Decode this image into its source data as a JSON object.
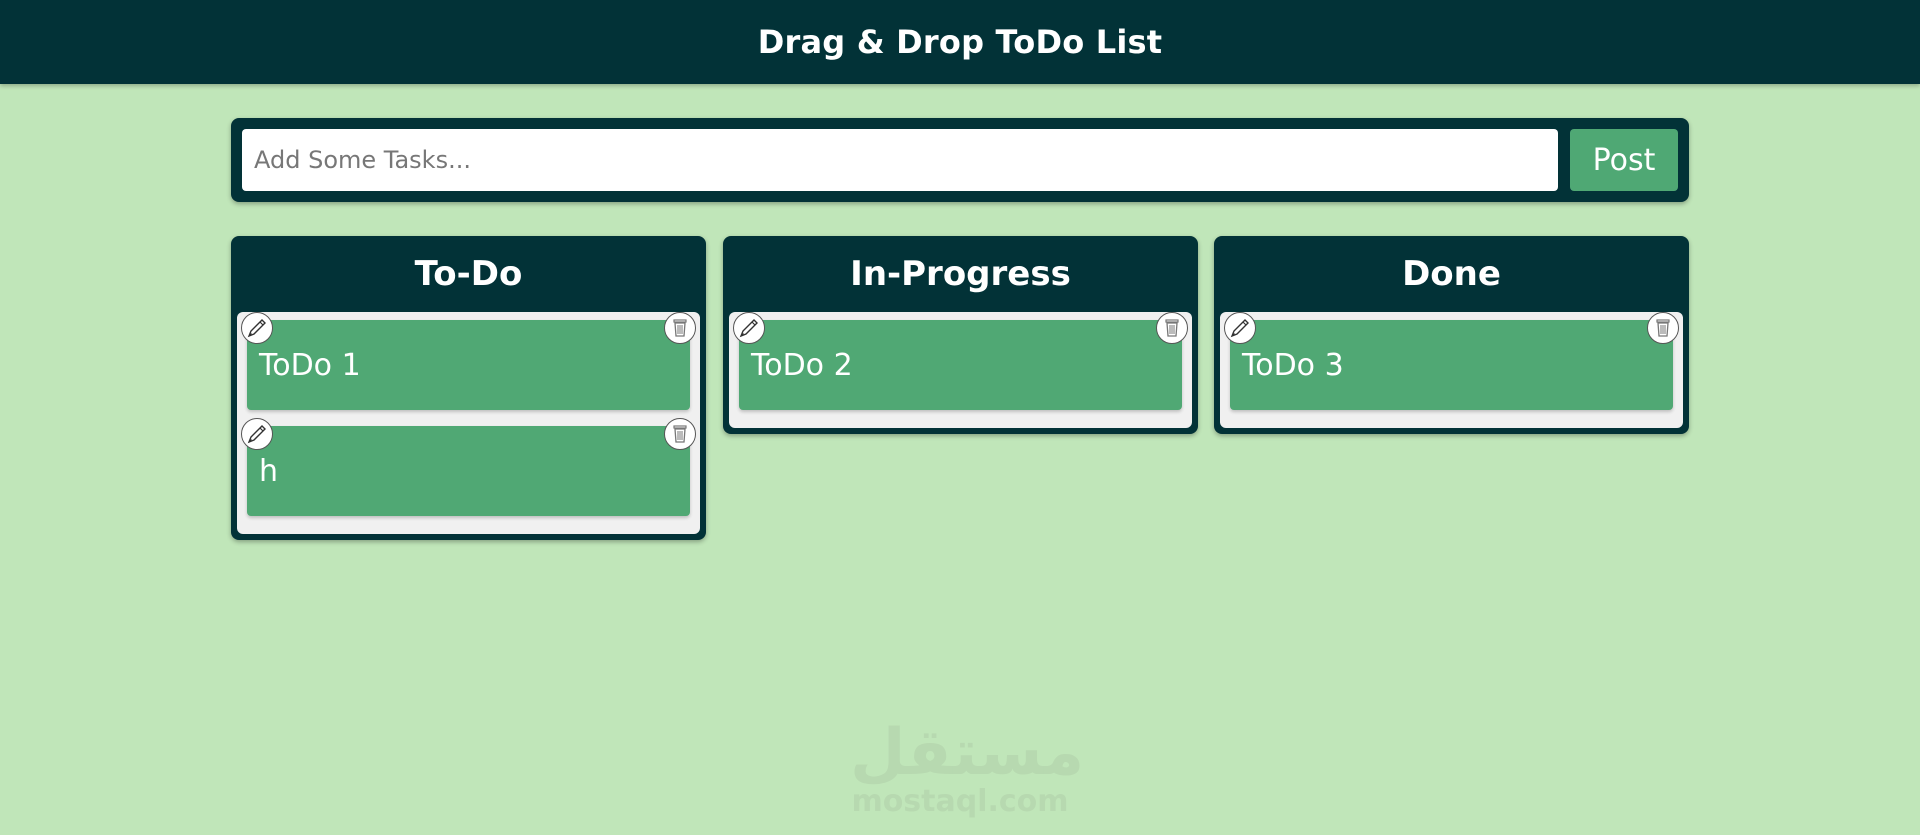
{
  "header": {
    "title": "Drag & Drop ToDo List"
  },
  "input_bar": {
    "placeholder": "Add Some Tasks...",
    "value": "",
    "post_label": "Post"
  },
  "columns": [
    {
      "title": "To-Do",
      "cards": [
        {
          "text": "ToDo 1"
        },
        {
          "text": "h"
        }
      ]
    },
    {
      "title": "In-Progress",
      "cards": [
        {
          "text": "ToDo 2"
        }
      ]
    },
    {
      "title": "Done",
      "cards": [
        {
          "text": "ToDo 3"
        }
      ]
    }
  ],
  "icons": {
    "edit": "pencil-icon",
    "delete": "trash-icon"
  },
  "watermark": {
    "arabic": "مستقل",
    "latin": "mostaql.com"
  },
  "colors": {
    "background": "#c0e6b9",
    "header": "#023237",
    "card": "#50a874",
    "post_button": "#4fa874"
  }
}
